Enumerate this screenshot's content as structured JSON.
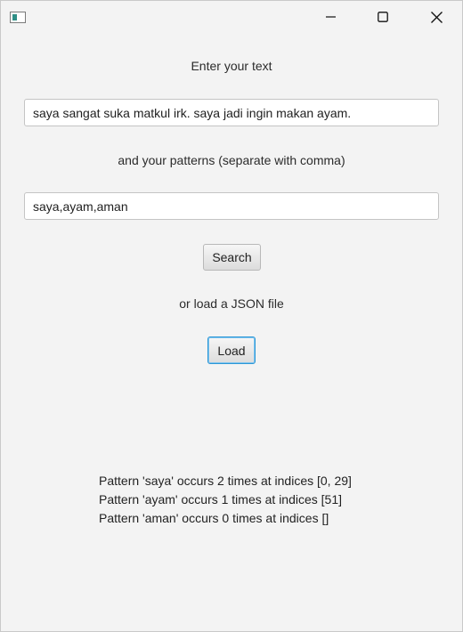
{
  "window": {
    "title_icon": "window-icon",
    "minimize_icon": "minimize-icon",
    "maximize_icon": "maximize-icon",
    "close_icon": "close-icon"
  },
  "text_section": {
    "label": "Enter your text",
    "value": "saya sangat suka matkul irk. saya jadi ingin makan ayam."
  },
  "pattern_section": {
    "label": "and your patterns (separate with comma)",
    "value": "saya,ayam,aman"
  },
  "search_button": {
    "label": "Search"
  },
  "json_section": {
    "label": "or load a JSON file"
  },
  "load_button": {
    "label": "Load"
  },
  "results": [
    "Pattern 'saya' occurs 2 times at indices [0, 29]",
    "Pattern 'ayam' occurs 1 times at indices [51]",
    "Pattern 'aman' occurs 0 times at indices []"
  ],
  "colors": {
    "background": "#f3f3f3",
    "focus_border": "#2c97d6"
  }
}
